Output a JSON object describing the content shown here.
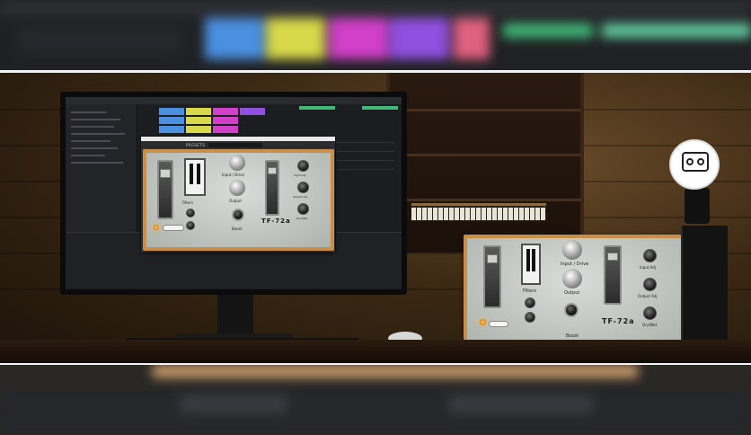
{
  "plugin": {
    "preset_label": "PRESETS",
    "knob_labels": {
      "input_drive": "Input / Drive",
      "output": "Output",
      "filters": "Filters",
      "boost": "Boost",
      "input_adj": "Input Adj",
      "output_adj": "Output Adj",
      "dry_wet": "Dry/Wet"
    },
    "model_name": "TF-72a"
  },
  "colors": {
    "frame_wood": "#c88f4a",
    "face_metal": "#c4c8c4",
    "lamp_orange": "#e88a10",
    "clip_blue": "#4a8fe0",
    "clip_yellow": "#d8d84a",
    "clip_magenta": "#d040c8",
    "clip_purple": "#9050e0",
    "clip_green": "#40b878"
  }
}
